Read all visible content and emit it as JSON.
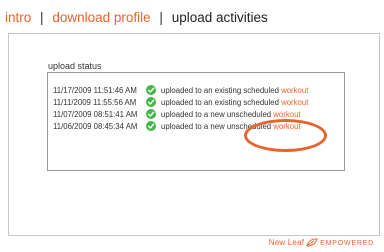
{
  "nav": {
    "intro": "intro",
    "separator": "|",
    "download_profile": "download profile",
    "upload_activities": "upload activities"
  },
  "status": {
    "title": "upload status",
    "rows": [
      {
        "timestamp": "11/17/2009 11:51:46 AM",
        "message": "uploaded to an existing scheduled",
        "link": "workout"
      },
      {
        "timestamp": "11/11/2009 11:55:56 AM",
        "message": "uploaded to an existing scheduled",
        "link": "workout"
      },
      {
        "timestamp": "11/07/2009 08:51:41 AM",
        "message": "uploaded to a new unscheduled",
        "link": "workout"
      },
      {
        "timestamp": "11/06/2009 08:45:34 AM",
        "message": "uploaded to a new unscheduled",
        "link": "workout"
      }
    ]
  },
  "brand": {
    "name": "New Leaf",
    "tagline": "EMPOWERED"
  },
  "colors": {
    "accent": "#e8642c",
    "check": "#45b649",
    "border": "#c7c7c7"
  },
  "icons": {
    "status": "check-circle-icon",
    "brand": "leaf-icon"
  }
}
